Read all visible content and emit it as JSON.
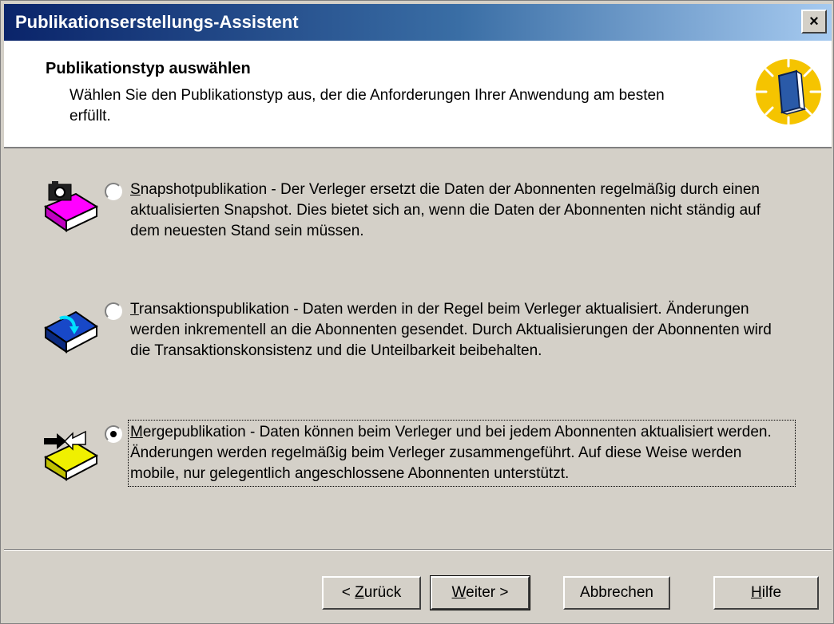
{
  "window": {
    "title": "Publikationserstellungs-Assistent",
    "close_label": "×"
  },
  "header": {
    "title": "Publikationstyp auswählen",
    "description": "Wählen Sie den Publikationstyp aus, der die Anforderungen Ihrer Anwendung am besten erfüllt.",
    "icon": "publication-book-icon"
  },
  "options": [
    {
      "key": "snapshot",
      "accel": "S",
      "text_rest": "napshotpublikation - Der Verleger ersetzt die Daten der Abonnenten regelmäßig durch einen aktualisierten Snapshot. Dies bietet sich an, wenn die Daten der Abonnenten nicht ständig auf dem neuesten Stand sein müssen.",
      "selected": false,
      "icon": "snapshot-book-icon"
    },
    {
      "key": "transaction",
      "accel": "T",
      "text_rest": "ransaktionspublikation - Daten werden in der Regel beim Verleger aktualisiert. Änderungen werden inkrementell an die Abonnenten gesendet. Durch Aktualisierungen der Abonnenten wird die Transaktionskonsistenz und die Unteilbarkeit beibehalten.",
      "selected": false,
      "icon": "transaction-book-icon"
    },
    {
      "key": "merge",
      "accel": "M",
      "text_rest": "ergepublikation - Daten können beim Verleger und bei jedem Abonnenten aktualisiert werden. Änderungen werden regelmäßig beim Verleger zusammengeführt. Auf diese Weise werden mobile, nur gelegentlich angeschlossene Abonnenten unterstützt.",
      "selected": true,
      "icon": "merge-book-icon"
    }
  ],
  "buttons": {
    "back_prefix": "< ",
    "back_accel": "Z",
    "back_rest": "urück",
    "next_accel": "W",
    "next_rest": "eiter >",
    "cancel": "Abbrechen",
    "help_accel": "H",
    "help_rest": "ilfe"
  },
  "colors": {
    "titlebar_start": "#0a246a",
    "titlebar_end": "#a6caf0",
    "dialog_bg": "#d4d0c8"
  }
}
